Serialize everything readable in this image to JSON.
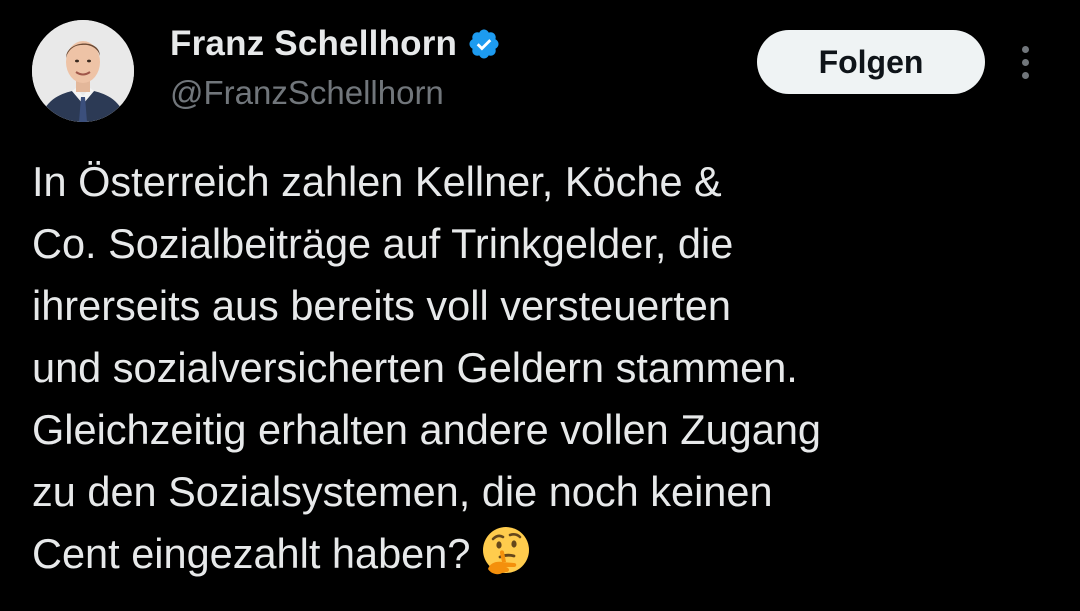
{
  "author": {
    "display_name": "Franz Schellhorn",
    "handle": "@FranzSchellhorn",
    "verified": true,
    "avatar_icon": "profile-photo"
  },
  "actions": {
    "follow_label": "Folgen",
    "more_icon": "vertical-ellipsis-icon"
  },
  "tweet": {
    "lines": [
      "In Österreich zahlen Kellner, Köche &",
      "Co. Sozialbeiträge auf Trinkgelder, die",
      "ihrerseits aus bereits voll versteuerten",
      "und sozialversicherten Geldern stammen.",
      "Gleichzeitig erhalten andere vollen Zugang",
      "zu den Sozialsystemen, die noch keinen",
      "Cent eingezahlt haben?"
    ],
    "trailing_emoji": "thinking-face-emoji"
  },
  "colors": {
    "background": "#000000",
    "text_primary": "#e7e9ea",
    "text_secondary": "#71767b",
    "verified_blue": "#1d9bf0",
    "button_bg": "#eff3f4",
    "button_text": "#0f1419"
  }
}
